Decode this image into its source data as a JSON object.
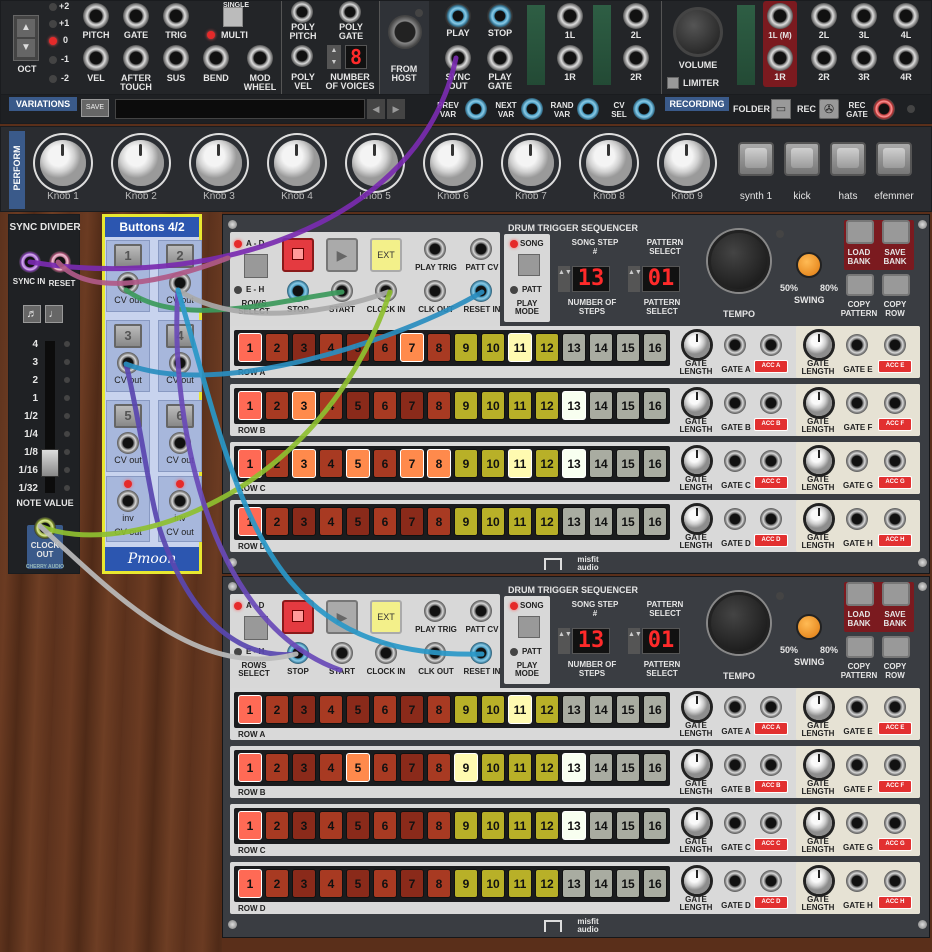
{
  "oct_values": [
    "+2",
    "+1",
    "0",
    "-1",
    "-2"
  ],
  "oct_label": "OCT",
  "midi_labels_top": [
    "PITCH",
    "GATE",
    "TRIG"
  ],
  "midi_labels_bottom": [
    "VEL",
    "AFTER TOUCH",
    "SUS",
    "BEND",
    "MOD WHEEL"
  ],
  "mode": {
    "single": "SINGLE",
    "multi": "MULTI"
  },
  "poly": {
    "pitch": "POLY PITCH",
    "gate": "POLY GATE",
    "vel": "POLY VEL",
    "voices_label": "NUMBER OF VOICES",
    "voices_value": "8"
  },
  "from_host": "FROM HOST",
  "transport": {
    "play": "PLAY",
    "stop": "STOP",
    "sync_out": "SYNC OUT",
    "play_gate": "PLAY GATE"
  },
  "audio_in": [
    "1L",
    "2L",
    "1R",
    "2R"
  ],
  "volume": {
    "label": "VOLUME",
    "limiter": "LIMITER"
  },
  "audio_out_top": [
    "1L (M)",
    "2L",
    "3L",
    "4L"
  ],
  "audio_out_bottom": [
    "1R",
    "2R",
    "3R",
    "4R"
  ],
  "variations": {
    "title": "VARIATIONS",
    "save": "SAVE",
    "prev": "PREV VAR",
    "next": "NEXT VAR",
    "rand": "RAND VAR",
    "cv_sel": "CV SEL"
  },
  "recording": {
    "title": "RECORDING",
    "folder": "FOLDER",
    "rec": "REC",
    "rec_gate": "REC GATE"
  },
  "perform": {
    "title": "PERFORM",
    "knobs": [
      "Knob 1",
      "Knob 2",
      "Knob 3",
      "Knob 4",
      "Knob 5",
      "Knob 6",
      "Knob 7",
      "Knob 8",
      "Knob 9"
    ],
    "buttons": [
      "synth 1",
      "kick",
      "hats",
      "efemmer"
    ]
  },
  "sync_divider": {
    "title": "SYNC DIVIDER",
    "sync_in": "SYNC IN",
    "reset": "RESET",
    "note_value": "NOTE VALUE",
    "clock_out": "CLOCK OUT",
    "brand": "CHERRY AUDIO",
    "scale": [
      "4",
      "3",
      "2",
      "1",
      "1/2",
      "1/4",
      "1/8",
      "1/16",
      "1/32"
    ]
  },
  "buttons_module": {
    "title": "Buttons 4/2",
    "buttons": [
      "1",
      "2",
      "3",
      "4",
      "5",
      "6"
    ],
    "cv_out": "CV out",
    "inv": "inv",
    "brand": "Pmoon"
  },
  "seq": {
    "title": "DRUM TRIGGER SEQUENCER",
    "rows_sel": "A - D",
    "rows_sel2": "E - H",
    "rows_select": "ROWS SELECT",
    "stop": "STOP",
    "start": "START",
    "ext": "EXT",
    "clock_in": "CLOCK IN",
    "play_trig": "PLAY TRIG",
    "clk_out": "CLK OUT",
    "patt_cv": "PATT CV",
    "reset_in": "RESET IN",
    "song": "SONG",
    "patt": "PATT",
    "play_mode": "PLAY MODE",
    "song_step": "SONG STEP #",
    "pattern_select": "PATTERN SELECT",
    "steps_value": "13",
    "pattern_value": "01",
    "number_of_steps": "NUMBER OF STEPS",
    "tempo": "TEMPO",
    "swing": "SWING",
    "swing_lo": "50%",
    "swing_hi": "80%",
    "load_bank": "LOAD BANK",
    "save_bank": "SAVE BANK",
    "copy_pattern": "COPY PATTERN",
    "copy_row": "COPY ROW",
    "gate_length": "GATE LENGTH",
    "rows": [
      {
        "name": "ROW A",
        "gate": "GATE A",
        "gate2": "GATE E",
        "acc": "ACC A",
        "acc2": "ACC E"
      },
      {
        "name": "ROW B",
        "gate": "GATE B",
        "gate2": "GATE F",
        "acc": "ACC B",
        "acc2": "ACC F"
      },
      {
        "name": "ROW C",
        "gate": "GATE C",
        "gate2": "GATE G",
        "acc": "ACC C",
        "acc2": "ACC G"
      },
      {
        "name": "ROW D",
        "gate": "GATE D",
        "gate2": "GATE H",
        "acc": "ACC D",
        "acc2": "ACC H"
      }
    ],
    "steps": [
      "1",
      "2",
      "3",
      "4",
      "5",
      "6",
      "7",
      "8",
      "9",
      "10",
      "11",
      "12",
      "13",
      "14",
      "15",
      "16"
    ],
    "brand": "misfit audio"
  },
  "seq1_active": [
    [
      1,
      7,
      11
    ],
    [
      1,
      3,
      13
    ],
    [
      1,
      3,
      5,
      7,
      8,
      11,
      13
    ],
    [
      1
    ]
  ],
  "seq2_active": [
    [
      1,
      11
    ],
    [
      1,
      5,
      9,
      13
    ],
    [
      1,
      13
    ],
    [
      1
    ]
  ]
}
